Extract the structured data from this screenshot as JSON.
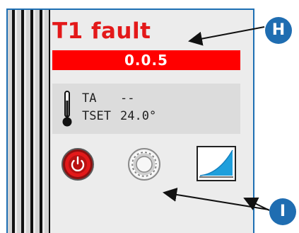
{
  "device": {
    "fault_title": "T1 fault",
    "fault_code": "0.0.5",
    "temperature": {
      "actual_label": "TA",
      "actual_value": "--",
      "setpoint_label": "TSET",
      "setpoint_value": "24.0°"
    },
    "buttons": [
      {
        "name": "power-button",
        "icon": "power-icon"
      },
      {
        "name": "settings-button",
        "icon": "gear-icon"
      },
      {
        "name": "ramp-button",
        "icon": "ramp-curve-icon"
      }
    ]
  },
  "annotations": {
    "marker_h": "H",
    "marker_i": "I"
  },
  "colors": {
    "fault_red": "#e3191a",
    "code_bar_red": "#ff0000",
    "frame_blue": "#1e6fb3",
    "marker_blue": "#1f6db1",
    "ramp_blue": "#1e9fdc"
  }
}
